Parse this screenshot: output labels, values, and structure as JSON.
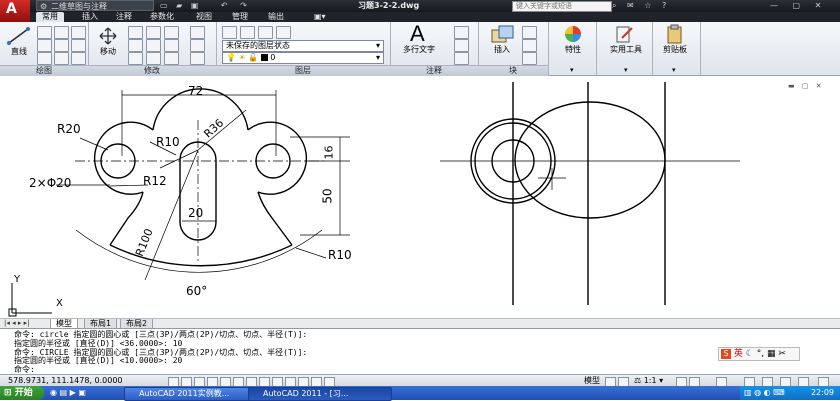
{
  "titlebar": {
    "logo_letter": "A",
    "workspace": "二维草图与注释",
    "file_title": "习题3-2-2.dwg",
    "search_placeholder": "键入关键字或短语"
  },
  "ribbon_tabs": [
    "常用",
    "插入",
    "注释",
    "参数化",
    "视图",
    "管理",
    "输出"
  ],
  "ribbon": {
    "line_label": "直线",
    "move_label": "移动",
    "layer_state": "未保存的图层状态",
    "layer_name": "0",
    "text_label": "多行文字",
    "insert_label": "插入",
    "properties_label": "特性",
    "utilities_label": "实用工具",
    "clipboard_label": "剪贴板",
    "panels": [
      "绘图",
      "修改",
      "图层",
      "注释",
      "块"
    ]
  },
  "drawing": {
    "dims": [
      "72",
      "R20",
      "R10",
      "R36",
      "16",
      "2×Φ20",
      "R12",
      "50",
      "20",
      "R100",
      "R10",
      "60°"
    ],
    "ucs_x": "X",
    "ucs_y": "Y"
  },
  "layout_tabs": [
    "模型",
    "布局1",
    "布局2"
  ],
  "command_lines": [
    "命令:  circle 指定圆的圆心或 [三点(3P)/两点(2P)/切点、切点、半径(T)]:",
    "指定圆的半径或 [直径(D)] <36.0000>: 10",
    "命令:  CIRCLE 指定圆的圆心或 [三点(3P)/两点(2P)/切点、切点、半径(T)]:",
    "指定圆的半径或 [直径(D)] <10.0000>: 20",
    "命令:"
  ],
  "ime": {
    "label": "英"
  },
  "status": {
    "coords": "578.9731, 111.1478, 0.0000",
    "model_label": "模型",
    "scale": "1:1"
  },
  "taskbar": {
    "start": "开始",
    "tasks": [
      "AutoCAD 2011实例教...",
      "AutoCAD 2011 - [习..."
    ],
    "clock": "22:09"
  }
}
